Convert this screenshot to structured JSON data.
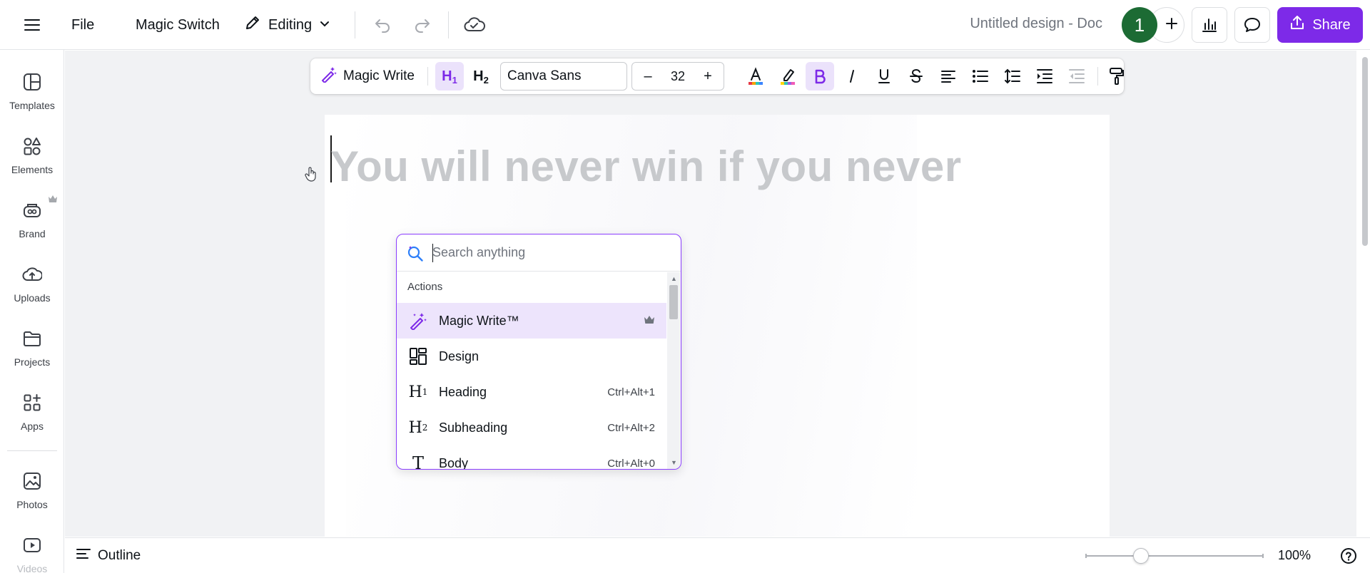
{
  "topbar": {
    "file_label": "File",
    "magic_switch_label": "Magic Switch",
    "editing_label": "Editing",
    "doc_title": "Untitled design - Doc",
    "avatar_initial": "1",
    "share_label": "Share"
  },
  "sidebar": {
    "items": [
      {
        "label": "Templates",
        "icon": "templates-icon"
      },
      {
        "label": "Elements",
        "icon": "elements-icon"
      },
      {
        "label": "Brand",
        "icon": "brand-icon"
      },
      {
        "label": "Uploads",
        "icon": "uploads-icon"
      },
      {
        "label": "Projects",
        "icon": "projects-icon"
      },
      {
        "label": "Apps",
        "icon": "apps-icon"
      },
      {
        "label": "Photos",
        "icon": "photos-icon"
      },
      {
        "label": "Videos",
        "icon": "videos-icon"
      }
    ]
  },
  "toolbar": {
    "magic_write_label": "Magic Write",
    "font_name": "Canva Sans",
    "font_size": "32",
    "decrease_label": "–",
    "increase_label": "+"
  },
  "document": {
    "heading_text": "You will never win if you never"
  },
  "palette": {
    "search_placeholder": "Search anything",
    "section_label": "Actions",
    "items": [
      {
        "label": "Magic Write™",
        "shortcut": "",
        "icon": "magic-write-icon",
        "premium": true
      },
      {
        "label": "Design",
        "shortcut": "",
        "icon": "design-icon",
        "premium": false
      },
      {
        "label": "Heading",
        "shortcut": "Ctrl+Alt+1",
        "icon": "heading-icon",
        "premium": false
      },
      {
        "label": "Subheading",
        "shortcut": "Ctrl+Alt+2",
        "icon": "subheading-icon",
        "premium": false
      },
      {
        "label": "Body",
        "shortcut": "Ctrl+Alt+0",
        "icon": "body-text-icon",
        "premium": false
      }
    ]
  },
  "bottombar": {
    "outline_label": "Outline",
    "zoom_label": "100%"
  },
  "colors": {
    "accent": "#7d2ae8",
    "avatar_bg": "#1c6b34",
    "highlight_bg": "#ede4fc"
  }
}
